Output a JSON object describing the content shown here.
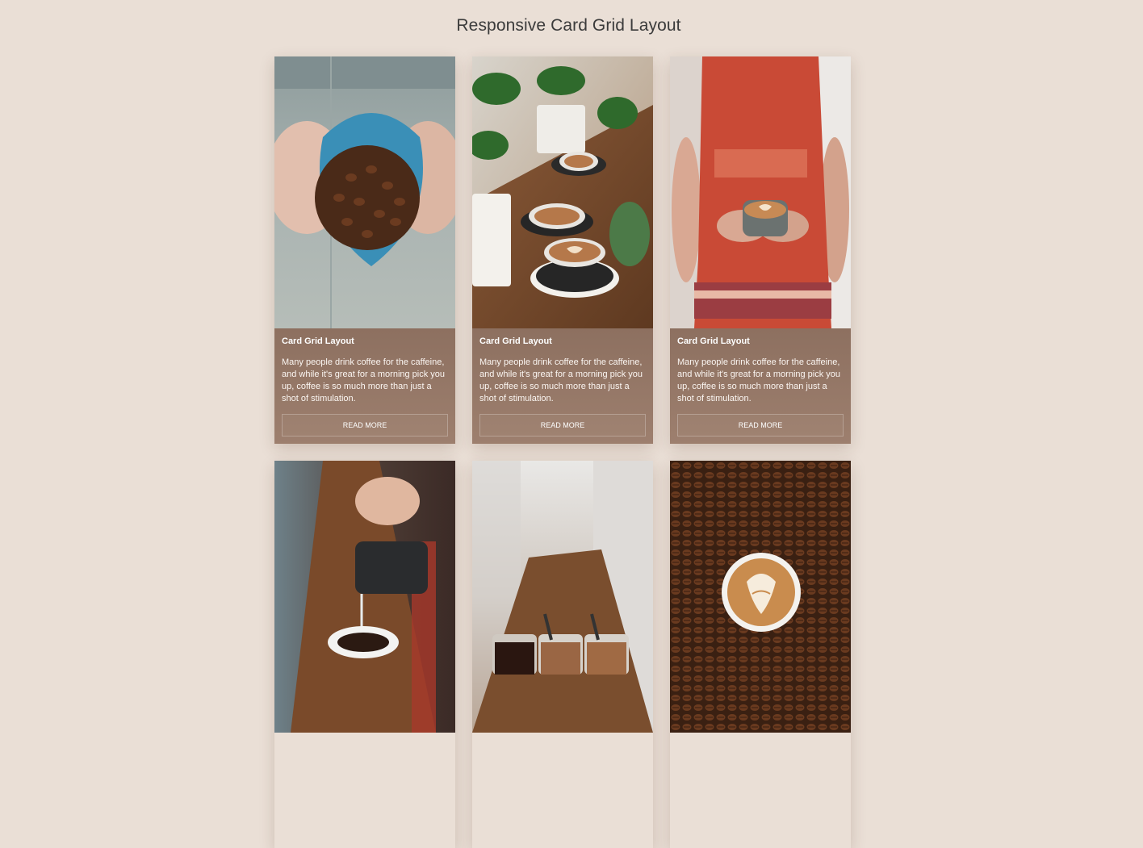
{
  "page": {
    "title": "Responsive Card Grid Layout"
  },
  "cards": [
    {
      "image_desc": "hands holding blue bag of coffee beans",
      "title": "Card Grid Layout",
      "text": "Many people drink coffee for the caffeine, and while it's great for a morning pick you up, coffee is so much more than just a shot of stimulation.",
      "button": "READ MORE"
    },
    {
      "image_desc": "latte cups on wooden table with plants",
      "title": "Card Grid Layout",
      "text": "Many people drink coffee for the caffeine, and while it's great for a morning pick you up, coffee is so much more than just a shot of stimulation.",
      "button": "READ MORE"
    },
    {
      "image_desc": "woman in red dress holding latte cup",
      "title": "Card Grid Layout",
      "text": "Many people drink coffee for the caffeine, and while it's great for a morning pick you up, coffee is so much more than just a shot of stimulation.",
      "button": "READ MORE"
    },
    {
      "image_desc": "milk being poured into coffee cup"
    },
    {
      "image_desc": "coffee glasses on wooden bar counter"
    },
    {
      "image_desc": "latte cup surrounded by coffee beans"
    }
  ],
  "colors": {
    "background": "#eadfd6",
    "card_body": "#937565",
    "title": "#3b3b3b"
  }
}
